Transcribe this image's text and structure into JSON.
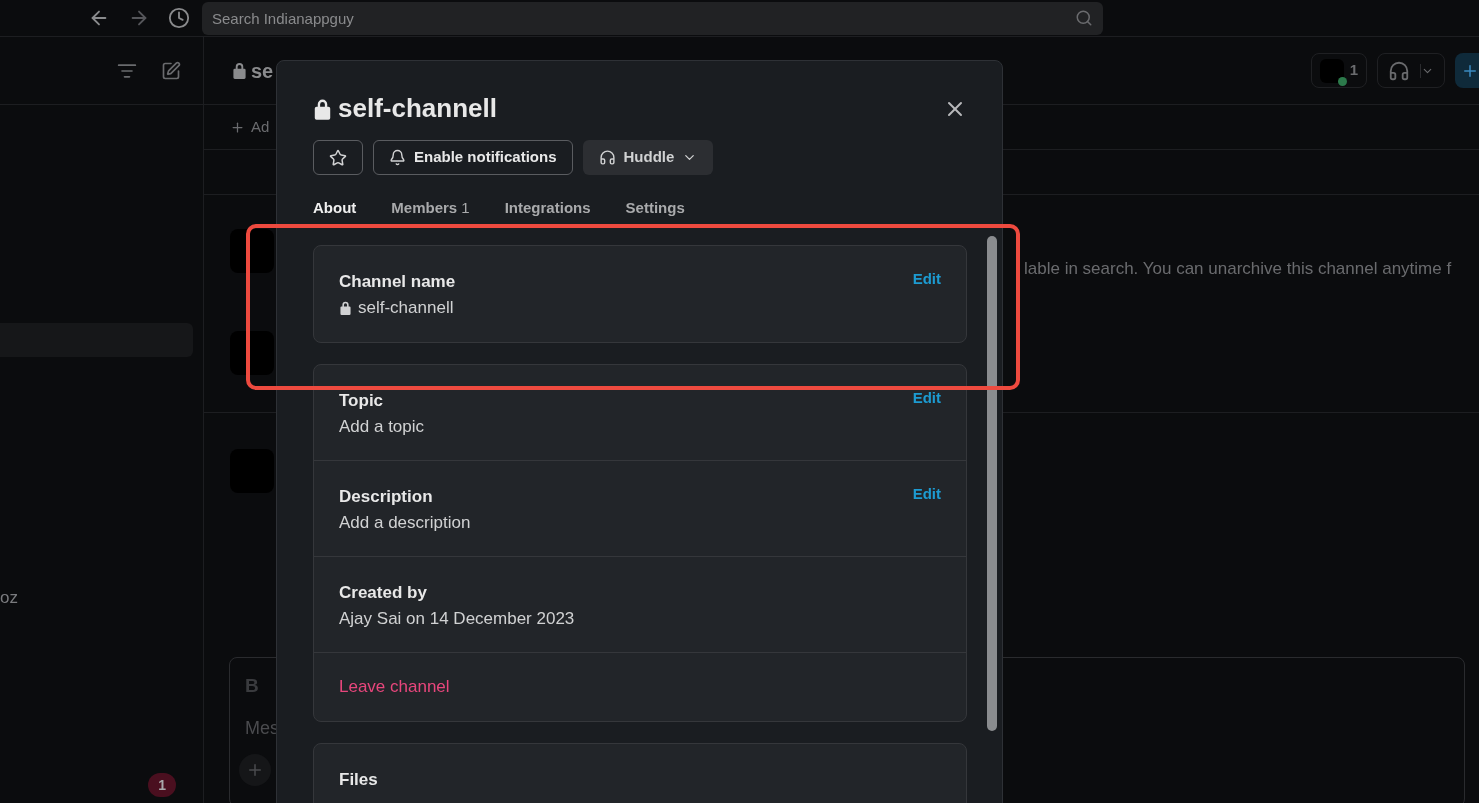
{
  "top_bar": {
    "search": {
      "placeholder": "Search Indianappguy"
    }
  },
  "sidebar": {
    "fragment": "oz",
    "badge": "1"
  },
  "channel_header": {
    "title": "se",
    "member_count": "1"
  },
  "bookmark_bar": {
    "add_label": "Ad"
  },
  "archived_notice": "lable in search. You can unarchive this channel anytime f",
  "composer": {
    "format_button": "B",
    "placeholder": "Mes"
  },
  "modal": {
    "title": "self-channell",
    "locked": true,
    "notifications_button": "Enable notifications",
    "huddle_button": "Huddle",
    "tabs": [
      {
        "label": "About",
        "selected": true
      },
      {
        "label": "Members",
        "count": "1",
        "selected": false
      },
      {
        "label": "Integrations",
        "selected": false
      },
      {
        "label": "Settings",
        "selected": false
      }
    ],
    "cards": [
      {
        "rows": [
          {
            "kind": "field",
            "label": "Channel name",
            "value": "self-channell",
            "locked": true,
            "action": "Edit"
          }
        ]
      },
      {
        "rows": [
          {
            "kind": "field",
            "label": "Topic",
            "value": "Add a topic",
            "locked": false,
            "action": "Edit"
          },
          {
            "kind": "field",
            "label": "Description",
            "value": "Add a description",
            "locked": false,
            "action": "Edit"
          },
          {
            "kind": "field",
            "label": "Created by",
            "value": "Ajay Sai on 14 December 2023",
            "locked": false
          },
          {
            "kind": "danger",
            "label": "Leave channel"
          }
        ]
      },
      {
        "rows": [
          {
            "kind": "field",
            "label": "Files"
          }
        ]
      }
    ]
  }
}
